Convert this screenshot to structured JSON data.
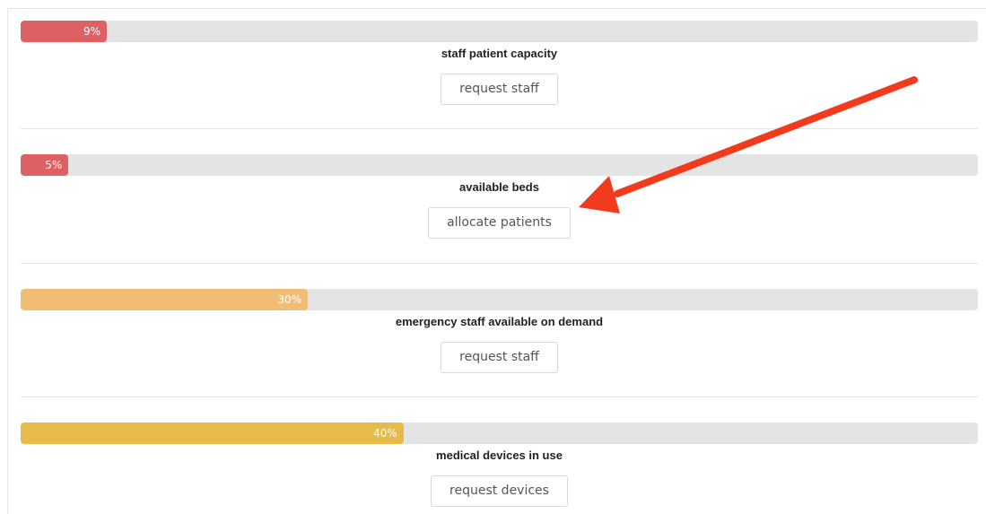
{
  "colors": {
    "red": "#dd6062",
    "orange": "#f1bd76",
    "yellow": "#e6bb4a",
    "track": "#e4e4e4",
    "annotation_arrow": "#f23b1d"
  },
  "metrics": [
    {
      "percent_label": "9%",
      "percent": 9,
      "title": "staff patient capacity",
      "button_label": "request staff",
      "color": "#dd6062"
    },
    {
      "percent_label": "5%",
      "percent": 5,
      "title": "available beds",
      "button_label": "allocate patients",
      "color": "#dd6062"
    },
    {
      "percent_label": "30%",
      "percent": 30,
      "title": "emergency staff available on demand",
      "button_label": "request staff",
      "color": "#f1bd76"
    },
    {
      "percent_label": "40%",
      "percent": 40,
      "title": "medical devices in use",
      "button_label": "request devices",
      "color": "#e6bb4a"
    }
  ]
}
